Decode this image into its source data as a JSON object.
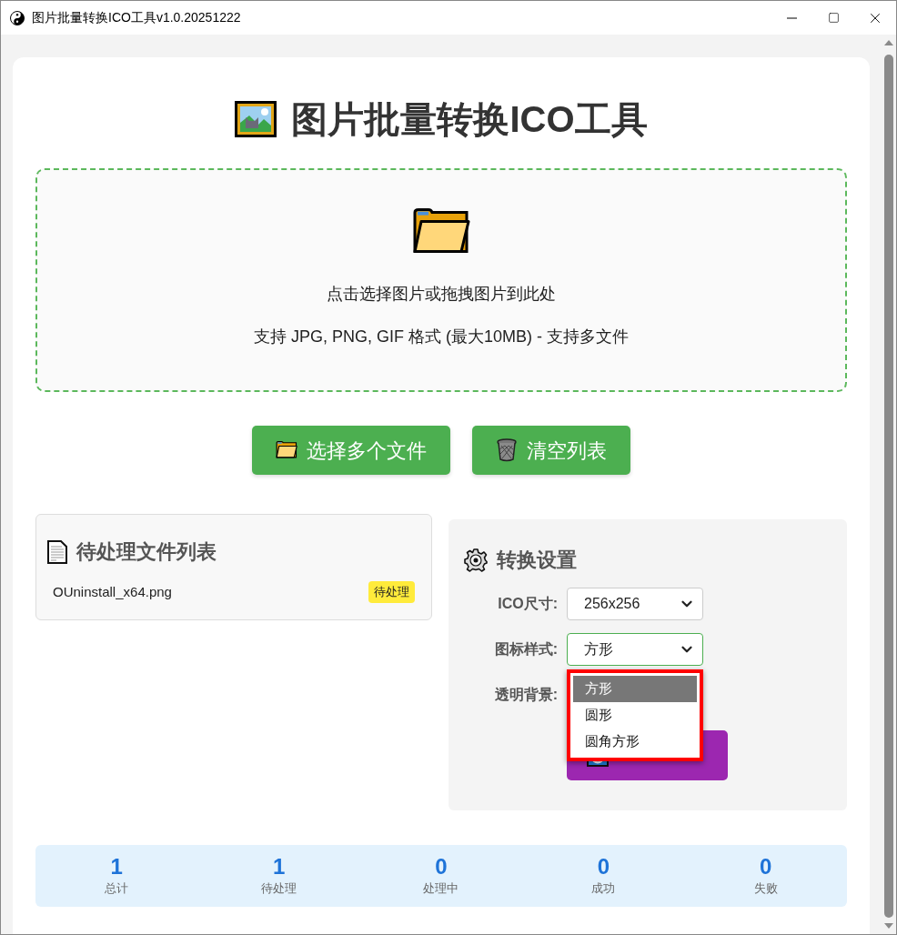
{
  "window": {
    "title": "图片批量转换ICO工具v1.0.20251222"
  },
  "header": {
    "title": "图片批量转换ICO工具"
  },
  "drop_zone": {
    "prompt": "点击选择图片或拖拽图片到此处",
    "hint": "支持 JPG, PNG, GIF 格式 (最大10MB) - 支持多文件"
  },
  "actions": [
    {
      "kind": "select",
      "label": "选择多个文件"
    },
    {
      "kind": "clear",
      "label": "清空列表"
    }
  ],
  "file_list": {
    "title": "待处理文件列表",
    "files": [
      {
        "name": "OUninstall_x64.png",
        "status": "待处理"
      }
    ]
  },
  "settings": {
    "title": "转换设置",
    "fields": [
      {
        "kind": "select",
        "label": "ICO尺寸:",
        "value": "256x256",
        "focused": false
      },
      {
        "kind": "select",
        "label": "图标样式:",
        "value": "方形",
        "focused": true,
        "dropdown": [
          {
            "label": "方形",
            "selected": true
          },
          {
            "label": "圆形",
            "selected": false
          },
          {
            "label": "圆角方形",
            "selected": false
          }
        ]
      },
      {
        "kind": "hidden",
        "label": "透明背景:"
      }
    ]
  },
  "stats": [
    {
      "value": "1",
      "label": "总计"
    },
    {
      "value": "1",
      "label": "待处理"
    },
    {
      "value": "0",
      "label": "处理中"
    },
    {
      "value": "0",
      "label": "成功"
    },
    {
      "value": "0",
      "label": "失败"
    }
  ]
}
